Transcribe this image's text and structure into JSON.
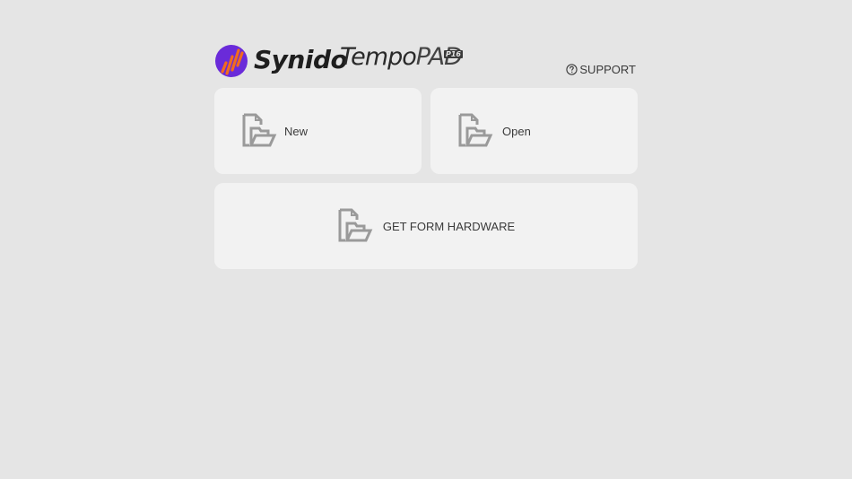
{
  "header": {
    "brand_name": "Synido",
    "product_name_main": "Tempo",
    "product_name_suffix": "PAD",
    "product_badge": "P16",
    "support_label": "SUPPORT"
  },
  "cards": {
    "new_label": "New",
    "open_label": "Open",
    "hardware_label": "GET FORM HARDWARE"
  },
  "icons": {
    "brand": "synido-logo-icon",
    "support": "question-circle-icon",
    "new": "document-folder-icon",
    "open": "document-folder-icon",
    "hardware": "document-folder-icon"
  },
  "colors": {
    "background": "#e5e5e5",
    "card": "#f2f2f2",
    "logo_purple": "#6a2bd9",
    "logo_orange": "#f26b1d",
    "icon_gray": "#9a9a9a",
    "text": "#3a3a3a"
  }
}
